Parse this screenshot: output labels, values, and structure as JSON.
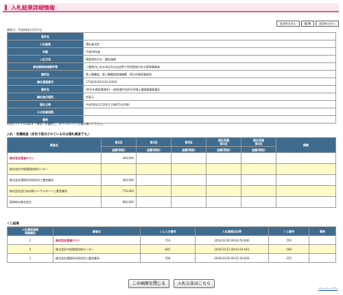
{
  "header": {
    "title": "入札結果詳細情報"
  },
  "font_buttons": {
    "large": "文字を大きく",
    "standard": "標 準",
    "small": "文字を小さく"
  },
  "updated": "更新日：平成28年12月27日",
  "info_rows": [
    {
      "label": "案件名",
      "value": ""
    },
    {
      "label": "入札結果",
      "value": "落札者決定"
    },
    {
      "label": "年度",
      "value": "平成28年度"
    },
    {
      "label": "入札方式",
      "value": "随意契約方式・最低価格"
    },
    {
      "label": "参加資格地域要件等",
      "value": "三重県内にある本店又は支店等で利用登録がある登録事業者"
    },
    {
      "label": "課所名",
      "value": "県土整備部、県土整備部地域機関　四日市建設事務所"
    },
    {
      "label": "開札管理番号",
      "value": "173020161214131922"
    },
    {
      "label": "業件名",
      "value": "[四日市建設事務所] 一般県道鈴名四日市線土壌調査業務委託"
    },
    {
      "label": "開札執行場所",
      "value": "別表示"
    },
    {
      "label": "落札日時",
      "value": "平成28年12月26日 10時15分19秒"
    },
    {
      "label": "その他事項等",
      "value": ""
    },
    {
      "label": "備考",
      "value": ""
    }
  ],
  "note": "※添付ファイルは必ず「保存」を選択し、ダウンロードした後に開いて下さい。",
  "bids_title": "入札・見積経過（赤色で表示されているのは落札業者です。）",
  "bids_headers": {
    "company": "業者名",
    "r1": "第1回",
    "r2": "第2回",
    "r3": "第3回",
    "n1": "随名見積\n第1回",
    "n2": "随名見積\n第2回",
    "remark": "摘要",
    "sub": "金額(税抜)"
  },
  "bids": [
    {
      "company": "株式会社東海テクノ",
      "r1": "390,000",
      "winner": true
    },
    {
      "company": "株式会社中部環境技術センター",
      "r1": "",
      "winner": false
    },
    {
      "company": "株式会社環境科学研究所三重営業所",
      "r1": "300,000",
      "winner": false
    },
    {
      "company": "株式会社西日本技術コンサルタント三重営業所",
      "r1": "770,000",
      "winner": false
    },
    {
      "company": "東邦地水株式会社",
      "r1": "800,000",
      "winner": false
    }
  ],
  "results_title": "くじ結果",
  "results_headers": {
    "rank": "入札最低価格\n同順順位",
    "company": "業者名",
    "kuji": "くじ入力番号",
    "datetime": "入札書提出日時",
    "num": "くじ番号",
    "remark": "備考"
  },
  "results": [
    {
      "rank": "2",
      "company": "株式会社東海テクノ",
      "kuji": "710",
      "datetime": "2016/12/26 09:44:50.840",
      "num": "550",
      "winner": true
    },
    {
      "rank": "0",
      "company": "株式会社中部環境技術センター",
      "kuji": "845",
      "datetime": "2016/12/21 08:43:54.663",
      "num": "508",
      "winner": false
    },
    {
      "rank": "1",
      "company": "株式会社環境科学研究所三重営業所",
      "kuji": "456",
      "datetime": "2016/12/26 09:21:26.826",
      "num": "225",
      "winner": false
    }
  ],
  "buttons": {
    "close": "この画面を閉じる",
    "notice": "入札公告はこちら"
  },
  "pagetop": "ページトップへ",
  "colors": {
    "accent": "#e0306a",
    "header_bg": "#3f6b8e",
    "highlight": "#fffbc8",
    "winner": "#d0104a"
  }
}
